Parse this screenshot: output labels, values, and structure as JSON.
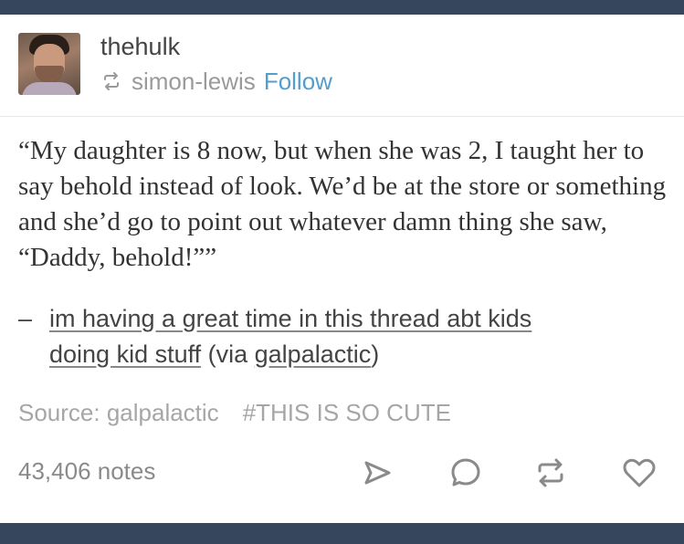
{
  "post": {
    "username": "thehulk",
    "reblogged_from": "simon-lewis",
    "follow_label": "Follow",
    "quote": "“My daughter is 8 now, but when she was 2, I taught her to say behold instead of look. We’d be at the store or something and she’d go to point out whatever damn thing she saw, “Daddy, behold!””",
    "attribution": {
      "dash": "–",
      "link_line1": "im having a great time in this thread abt kids",
      "link_line2": "doing kid stuff",
      "via_open": " (via ",
      "via_user": "galpalactic",
      "via_close": ")"
    },
    "source_label": "Source: galpalactic",
    "tag": "#THIS IS SO CUTE",
    "notes": "43,406 notes"
  },
  "actions": [
    {
      "icon": "share-icon"
    },
    {
      "icon": "reply-icon"
    },
    {
      "icon": "reblog-icon"
    },
    {
      "icon": "heart-icon"
    }
  ],
  "colors": {
    "header_bar": "#36465d",
    "follow": "#529ecc",
    "muted": "#a6a6a6"
  }
}
